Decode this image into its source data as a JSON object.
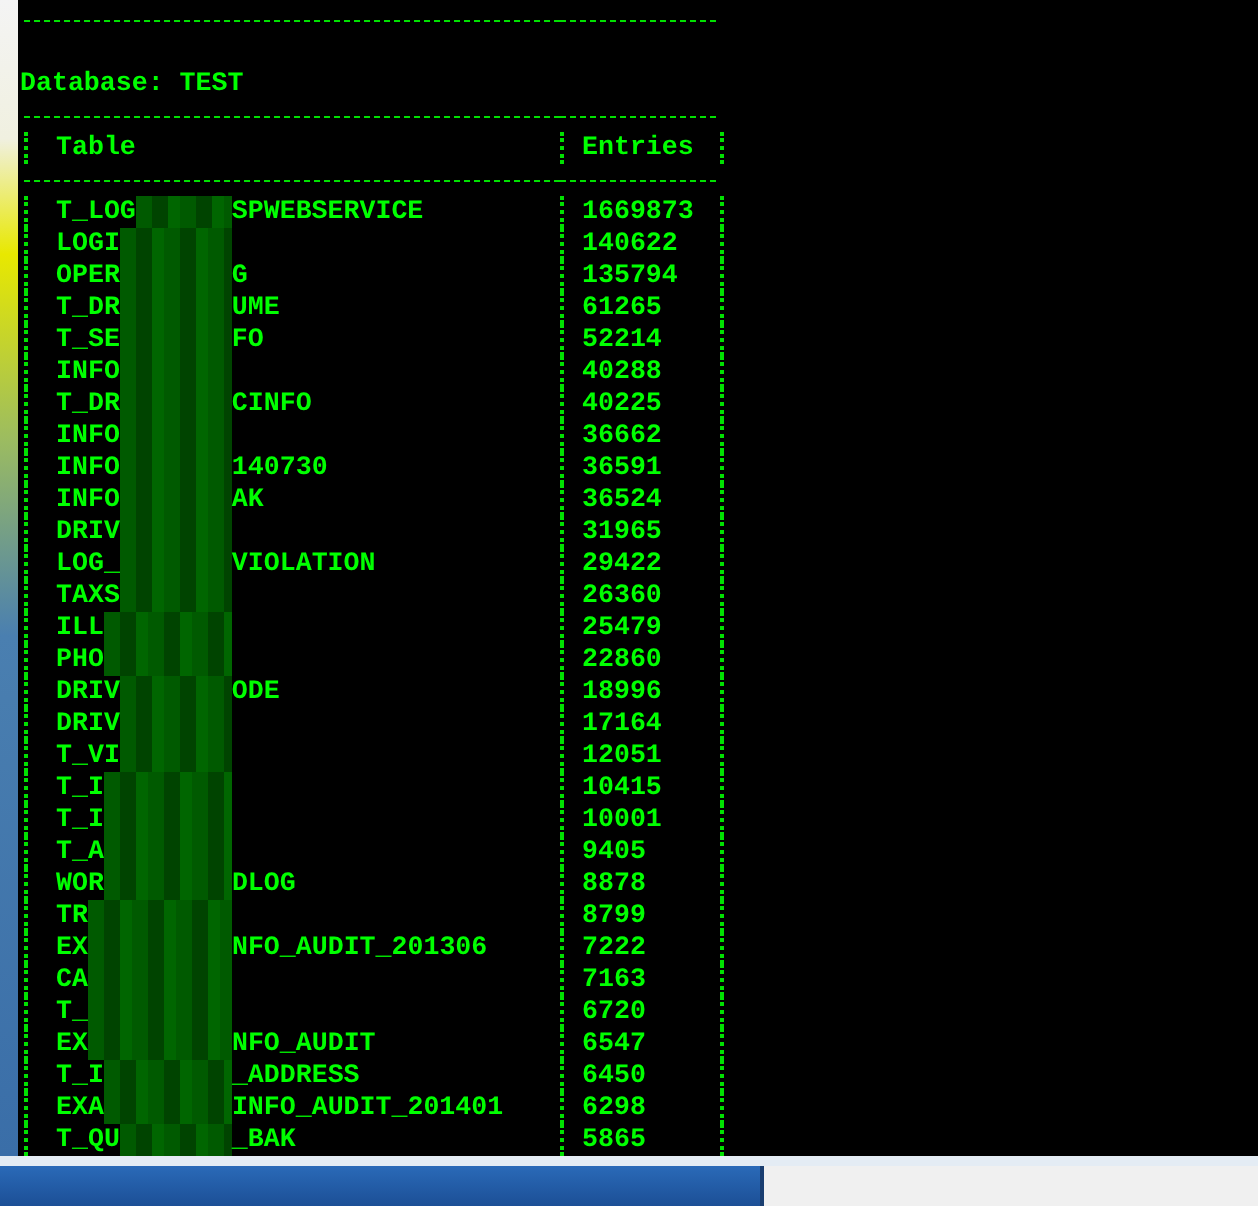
{
  "console": {
    "database_line": "Database: TEST",
    "columns": [
      "Table",
      "Entries"
    ],
    "rows": [
      {
        "start": "T_LOG",
        "end": "SPWEBSERVICE",
        "entries": "1669873"
      },
      {
        "start": "LOGI",
        "entries": "140622"
      },
      {
        "start": "OPER",
        "end": "G",
        "entries": "135794"
      },
      {
        "start": "T_DR",
        "end": "UME",
        "entries": "61265"
      },
      {
        "start": "T_SE",
        "end": "FO",
        "entries": "52214"
      },
      {
        "start": "INFO",
        "entries": "40288"
      },
      {
        "start": "T_DR",
        "end": "CINFO",
        "entries": "40225"
      },
      {
        "start": "INFO",
        "entries": "36662"
      },
      {
        "start": "INFO",
        "end": "140730",
        "entries": "36591"
      },
      {
        "start": "INFO",
        "end": "AK",
        "entries": "36524"
      },
      {
        "start": "DRIV",
        "entries": "31965"
      },
      {
        "start": "LOG_",
        "end": "VIOLATION",
        "entries": "29422"
      },
      {
        "start": "TAXS",
        "entries": "26360"
      },
      {
        "start": "ILL",
        "entries": "25479"
      },
      {
        "start": "PHO",
        "entries": "22860"
      },
      {
        "start": "DRIV",
        "end": "ODE",
        "entries": "18996"
      },
      {
        "start": "DRIV",
        "entries": "17164"
      },
      {
        "start": "T_VI",
        "entries": "12051"
      },
      {
        "start": "T_I",
        "entries": "10415"
      },
      {
        "start": "T_I",
        "entries": "10001"
      },
      {
        "start": "T_A",
        "entries": "9405"
      },
      {
        "start": "WOR",
        "end": "DLOG",
        "entries": "8878"
      },
      {
        "start": "TR",
        "entries": "8799"
      },
      {
        "start": "EX",
        "end": "NFO_AUDIT_201306",
        "entries": "7222"
      },
      {
        "start": "CA",
        "entries": "7163"
      },
      {
        "start": "T_",
        "entries": "6720"
      },
      {
        "start": "EX",
        "end": "NFO_AUDIT",
        "entries": "6547"
      },
      {
        "start": "T_I",
        "end": "_ADDRESS",
        "entries": "6450"
      },
      {
        "start": "EXA",
        "end": "INFO_AUDIT_201401",
        "entries": "6298"
      },
      {
        "start": "T_QU",
        "end": "_BAK",
        "entries": "5865"
      }
    ]
  }
}
